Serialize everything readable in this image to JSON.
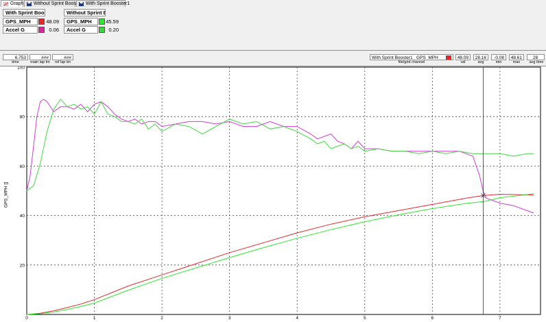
{
  "tabs": [
    {
      "label": "Graph",
      "active": true,
      "icon": "graph-icon"
    },
    {
      "label": "Without Sprint Booster",
      "active": false,
      "icon": "save-icon"
    },
    {
      "label": "With Sprint Booster1",
      "active": false,
      "icon": "save-icon"
    }
  ],
  "legend": {
    "groups": [
      {
        "header": "With Sprint Booste",
        "rows": [
          {
            "label": "GPS_MPH",
            "color": "#e8262c",
            "value": "48.09"
          },
          {
            "label": "Accel G",
            "color": "#e0239a",
            "value": "0.06"
          }
        ]
      },
      {
        "header": "Without Sprint Booste",
        "rows": [
          {
            "label": "GPS_MPH",
            "color": "#2ee82e",
            "value": "45.59"
          },
          {
            "label": "Accel G",
            "color": "#39d839",
            "value": "0.20"
          }
        ]
      }
    ]
  },
  "readouts": {
    "time": {
      "value": "6.753",
      "caption": "time"
    },
    "main_lap_tm": {
      "value": "###",
      "caption": "main lap tm"
    },
    "ref_lap_tm": {
      "value": "###",
      "caption": "ref lap tm"
    },
    "file_channel": {
      "file": "With Sprint Booster1",
      "channel": "GPS_MPH",
      "color": "#e8262c",
      "caption": "file/grid channel"
    },
    "val": {
      "value": "48.09",
      "caption": "val"
    },
    "avg": {
      "value": "28.16",
      "caption": "avg"
    },
    "min": {
      "value": "-0.08",
      "caption": "min"
    },
    "max": {
      "value": "48.61",
      "caption": "max"
    },
    "avg_time": {
      "value": "28",
      "caption": "avg time"
    }
  },
  "chart": {
    "ylabel": "GPS_MPH []",
    "cursor_time": 6.753
  },
  "chart_data": {
    "type": "line",
    "xlim": [
      0,
      7.6
    ],
    "ylim": [
      0,
      100
    ],
    "xticks": [
      "0",
      "1",
      "2",
      "3",
      "4",
      "5",
      "6",
      "7"
    ],
    "yticks": [
      "20",
      "40",
      "60",
      "80",
      "100"
    ],
    "grid": true,
    "ylabel": "GPS_MPH []",
    "series": [
      {
        "color": "#d23bd2",
        "x": [
          0,
          0.05,
          0.1,
          0.15,
          0.2,
          0.25,
          0.3,
          0.4,
          0.5,
          0.6,
          0.7,
          0.8,
          0.9,
          1.0,
          1.1,
          1.2,
          1.3,
          1.4,
          1.5,
          1.6,
          1.7,
          1.8,
          1.9,
          2.0,
          2.2,
          2.4,
          2.6,
          2.8,
          3.0,
          3.2,
          3.4,
          3.6,
          3.8,
          4.0,
          4.2,
          4.3,
          4.4,
          4.5,
          4.6,
          4.7,
          4.8,
          4.9,
          5.0,
          5.2,
          5.4,
          5.6,
          5.8,
          6.0,
          6.2,
          6.4,
          6.6,
          6.65,
          6.7,
          6.75,
          6.8,
          6.9,
          7.0,
          7.2,
          7.4,
          7.5
        ],
        "y": [
          50,
          56,
          68,
          80,
          86,
          87,
          86,
          82,
          84,
          84,
          83,
          85,
          82,
          85,
          86,
          84,
          81,
          79,
          78,
          79,
          77,
          78,
          78,
          76,
          77,
          78,
          78,
          77,
          78,
          76,
          76,
          78,
          76,
          76,
          73,
          71,
          72,
          73,
          70,
          69,
          67,
          70,
          67,
          67,
          66,
          66,
          66,
          66,
          66,
          66,
          64,
          60,
          56,
          50,
          47,
          46,
          45,
          44,
          42,
          41
        ]
      },
      {
        "color": "#3fd93f",
        "x": [
          0,
          0.1,
          0.2,
          0.3,
          0.4,
          0.5,
          0.6,
          0.7,
          0.8,
          0.9,
          1.0,
          1.1,
          1.2,
          1.3,
          1.4,
          1.5,
          1.6,
          1.7,
          1.8,
          1.9,
          2.0,
          2.2,
          2.4,
          2.6,
          2.8,
          3.0,
          3.2,
          3.4,
          3.6,
          3.8,
          4.0,
          4.2,
          4.3,
          4.4,
          4.5,
          4.6,
          4.7,
          4.8,
          4.9,
          5.0,
          5.2,
          5.4,
          5.6,
          5.8,
          6.0,
          6.2,
          6.4,
          6.6,
          6.8,
          7.0,
          7.2,
          7.4,
          7.5
        ],
        "y": [
          50,
          52,
          61,
          74,
          83,
          87,
          84,
          85,
          83,
          84,
          81,
          86,
          81,
          80,
          78,
          78,
          77,
          79,
          75,
          77,
          74,
          77,
          76,
          73,
          76,
          79,
          77,
          78,
          75,
          76,
          74,
          71,
          69,
          70,
          67,
          68,
          69,
          67,
          68,
          66,
          67,
          66,
          66,
          65,
          66,
          65,
          66,
          65,
          65,
          65,
          64,
          65,
          65
        ]
      },
      {
        "color": "#e8262c",
        "x": [
          0,
          0.2,
          0.4,
          0.6,
          0.8,
          1.0,
          1.5,
          2.0,
          2.5,
          3.0,
          3.5,
          4.0,
          4.5,
          5.0,
          5.5,
          6.0,
          6.5,
          6.75,
          7.0,
          7.5
        ],
        "y": [
          0,
          0.5,
          1.5,
          2.8,
          4.2,
          6,
          11.5,
          16,
          20.5,
          25,
          29,
          33,
          36.5,
          39.5,
          42,
          44.5,
          47,
          48.09,
          48.6,
          48.3
        ]
      },
      {
        "color": "#2ee82e",
        "x": [
          0,
          0.2,
          0.4,
          0.6,
          0.8,
          1.0,
          1.5,
          2.0,
          2.5,
          3.0,
          3.5,
          4.0,
          4.5,
          5.0,
          5.5,
          6.0,
          6.5,
          6.75,
          7.0,
          7.5
        ],
        "y": [
          0,
          0.3,
          1.0,
          2.0,
          3.2,
          4.6,
          9.8,
          14.6,
          18.8,
          23,
          27,
          30.8,
          34.3,
          37.5,
          40.3,
          42.8,
          44.9,
          45.59,
          47.2,
          48.8
        ]
      }
    ]
  }
}
